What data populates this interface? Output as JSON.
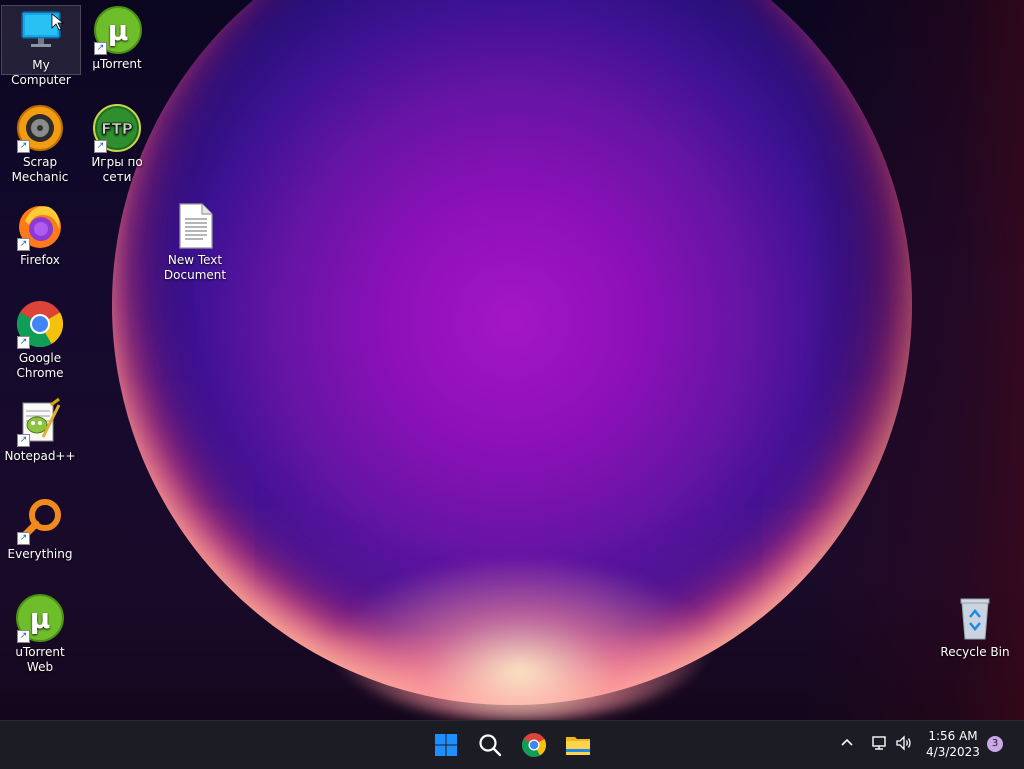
{
  "desktop": {
    "icons": [
      {
        "name": "My Computer"
      },
      {
        "name": "µTorrent"
      },
      {
        "name": "Scrap\nMechanic"
      },
      {
        "name": "Игры по сети"
      },
      {
        "name": "Firefox"
      },
      {
        "name": "New Text\nDocument"
      },
      {
        "name": "Google\nChrome"
      },
      {
        "name": "Notepad++"
      },
      {
        "name": "Everything"
      },
      {
        "name": "uTorrent Web"
      },
      {
        "name": "Recycle Bin"
      }
    ]
  },
  "taskbar": {
    "pinned": [
      "start-icon",
      "search-icon",
      "chrome-icon",
      "file-explorer-icon"
    ],
    "clock": {
      "time": "1:56 AM",
      "date": "4/3/2023"
    },
    "notification_count": "3"
  },
  "colors": {
    "taskbar_bg": "#1c1c24",
    "accent_blue": "#1f8fff"
  }
}
